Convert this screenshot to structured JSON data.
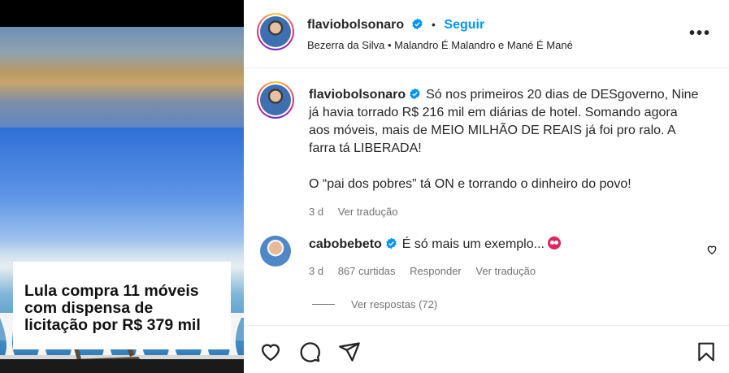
{
  "media": {
    "caption": "Lula compra 11 móveis com dispensa de licitação por R$ 379 mil"
  },
  "header": {
    "username": "flaviobolsonaro",
    "separator": "•",
    "follow_label": "Seguir",
    "audio": "Bezerra da Silva • Malandro É Malandro e Mané É Mané",
    "more_icon": "more-horizontal-icon"
  },
  "post": {
    "username": "flaviobolsonaro",
    "text_p1": "Só nos primeiros 20 dias de DESgoverno, Nine já havia torrado R$ 216 mil em diárias de hotel. Somando agora aos móveis, mais de MEIO MILHÃO DE REAIS já foi pro ralo. A farra tá LIBERADA!",
    "text_p2": "O “pai dos pobres” tá ON e torrando o dinheiro do povo!",
    "age": "3 d",
    "translate_label": "Ver tradução"
  },
  "comment": {
    "username": "cabobebeto",
    "text": "É só mais um exemplo...",
    "age": "3 d",
    "likes": "867 curtidas",
    "reply_label": "Responder",
    "translate_label": "Ver tradução",
    "view_replies": "Ver respostas (72)"
  },
  "colors": {
    "accent_blue": "#0095f6",
    "text": "#262626",
    "muted": "#737373"
  }
}
